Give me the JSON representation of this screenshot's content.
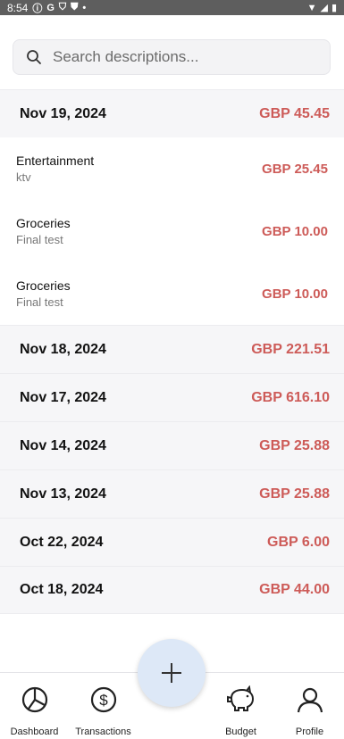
{
  "status_bar": {
    "time": "8:54",
    "icons": [
      "info-icon",
      "google-icon",
      "shield-icon",
      "shield-icon",
      "dot-icon"
    ],
    "right_icons": [
      "wifi-icon",
      "signal-icon",
      "battery-icon"
    ]
  },
  "search": {
    "placeholder": "Search descriptions...",
    "value": "",
    "icon": "search-icon"
  },
  "groups": [
    {
      "date": "Nov 19, 2024",
      "total": "GBP 45.45",
      "transactions": [
        {
          "category": "Entertainment",
          "description": "ktv",
          "amount": "GBP 25.45"
        },
        {
          "category": "Groceries",
          "description": "Final test",
          "amount": "GBP 10.00"
        },
        {
          "category": "Groceries",
          "description": "Final test",
          "amount": "GBP 10.00"
        }
      ]
    },
    {
      "date": "Nov 18, 2024",
      "total": "GBP 221.51",
      "transactions": []
    },
    {
      "date": "Nov 17, 2024",
      "total": "GBP 616.10",
      "transactions": []
    },
    {
      "date": "Nov 14, 2024",
      "total": "GBP 25.88",
      "transactions": []
    },
    {
      "date": "Nov 13, 2024",
      "total": "GBP 25.88",
      "transactions": []
    },
    {
      "date": "Oct 22, 2024",
      "total": "GBP 6.00",
      "transactions": []
    },
    {
      "date": "Oct 18, 2024",
      "total": "GBP 44.00",
      "transactions": []
    }
  ],
  "fab": {
    "icon": "plus-icon"
  },
  "bottom_nav": [
    {
      "label": "Dashboard",
      "icon": "dashboard-icon"
    },
    {
      "label": "Transactions",
      "icon": "dollar-circle-icon"
    },
    {
      "label": "",
      "icon": ""
    },
    {
      "label": "Budget",
      "icon": "piggy-bank-icon"
    },
    {
      "label": "Profile",
      "icon": "profile-icon"
    }
  ],
  "colors": {
    "amount": "#cd5b58",
    "header_bg": "#f6f6f8",
    "fab_bg": "#dde8f7",
    "status_bar_bg": "#5e5e5e"
  }
}
